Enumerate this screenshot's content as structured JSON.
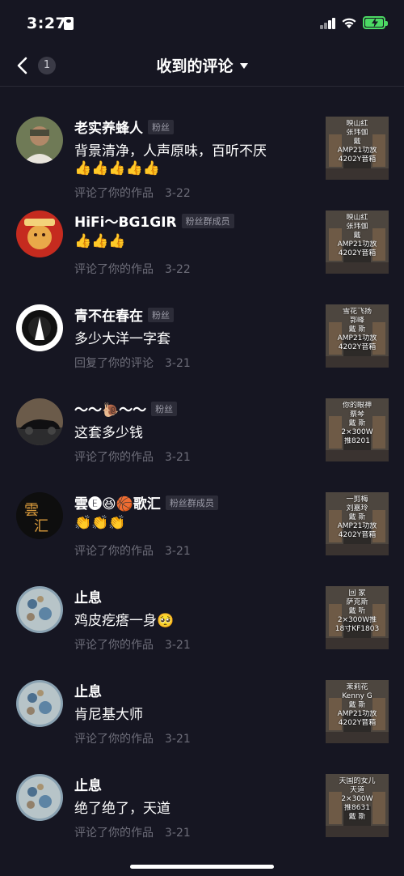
{
  "status_bar": {
    "time": "3:27"
  },
  "nav": {
    "back_count": "1",
    "title": "收到的评论"
  },
  "comments": [
    {
      "name": "老实养蜂人",
      "badge": "粉丝",
      "text": "背景清净，人声原味，百听不厌",
      "emoji": "👍👍👍👍👍",
      "action": "评论了你的作品",
      "date": "3-22",
      "thumb_lines": [
        "映山红",
        "张玮伽",
        "戴",
        "AMP21功放",
        "4202Y音箱"
      ]
    },
    {
      "name": "HiFi～BG1GIR",
      "badge": "粉丝群成员",
      "text": "",
      "emoji": "👍👍👍",
      "action": "评论了你的作品",
      "date": "3-22",
      "thumb_lines": [
        "映山红",
        "张玮伽",
        "戴",
        "AMP21功放",
        "4202Y音箱"
      ]
    },
    {
      "name": "青不在春在",
      "badge": "粉丝",
      "text": "多少大洋一字套",
      "emoji": "",
      "action": "回复了你的评论",
      "date": "3-21",
      "thumb_lines": [
        "雪花飞扬",
        "郭峰",
        "戴 斯",
        "AMP21功放",
        "4202Y音箱"
      ]
    },
    {
      "name": "～～🐌～～",
      "badge": "粉丝",
      "text": "这套多少钱",
      "emoji": "",
      "action": "评论了你的作品",
      "date": "3-21",
      "thumb_lines": [
        "你的眼神",
        "蔡琴",
        "戴 斯",
        "2×300W",
        "推8201"
      ]
    },
    {
      "name": "雲🅔😆🏀歌汇",
      "badge": "粉丝群成员",
      "text": "",
      "emoji": "👏👏👏",
      "action": "评论了你的作品",
      "date": "3-21",
      "thumb_lines": [
        "一剪梅",
        "刘嘉玲",
        "戴 斯",
        "AMP21功放",
        "4202Y音箱"
      ]
    },
    {
      "name": "止息",
      "badge": "",
      "text": "鸡皮疙瘩一身🥺",
      "emoji": "",
      "action": "评论了你的作品",
      "date": "3-21",
      "thumb_lines": [
        "回 家",
        "萨克斯",
        "戴 听",
        "2×300W推",
        "18寸KF1803"
      ]
    },
    {
      "name": "止息",
      "badge": "",
      "text": "肯尼基大师",
      "emoji": "",
      "action": "评论了你的作品",
      "date": "3-21",
      "thumb_lines": [
        "茉莉花",
        "Kenny G",
        "戴 斯",
        "AMP21功放",
        "4202Y音箱"
      ]
    },
    {
      "name": "止息",
      "badge": "",
      "text": "绝了绝了，天道",
      "emoji": "",
      "action": "评论了你的作品",
      "date": "3-21",
      "thumb_lines": [
        "天国的女儿",
        "天道",
        "2×300W",
        "推8631",
        "戴 斯"
      ]
    }
  ],
  "colors": {
    "background": "#161622",
    "secondary_text": "#6e6e7a",
    "badge_bg": "#2c2c38",
    "battery": "#4cd964"
  }
}
